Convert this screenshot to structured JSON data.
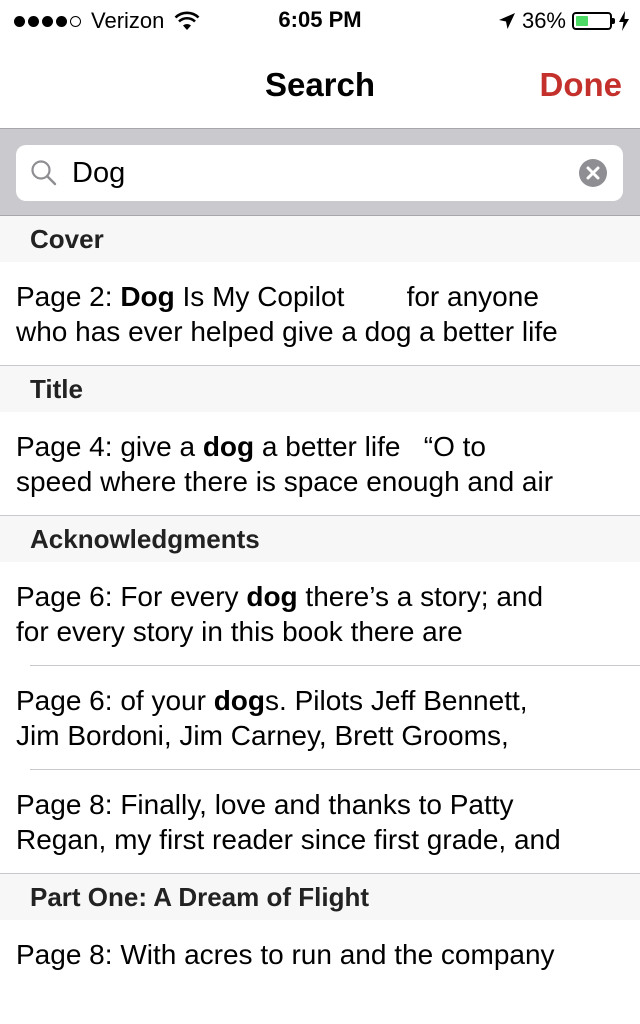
{
  "status_bar": {
    "carrier": "Verizon",
    "time": "6:05 PM",
    "battery": "36%",
    "battery_level": 0.36,
    "signal_bars_filled": 4,
    "signal_bars_total": 5
  },
  "nav": {
    "title": "Search",
    "done_label": "Done"
  },
  "search": {
    "value": "Dog"
  },
  "colors": {
    "accent": "#c4302b",
    "battery_fill": "#4cd964"
  },
  "sections": [
    {
      "header": "Cover",
      "results": [
        {
          "page": "Page 2: ",
          "line1_before": "",
          "match": "Dog",
          "line1_after": " Is My Copilot        for anyone",
          "line2": "who has ever helped give a dog a better life"
        }
      ]
    },
    {
      "header": "Title",
      "results": [
        {
          "page": "Page 4: ",
          "line1_before": "give a ",
          "match": "dog",
          "line1_after": " a better life   “O to",
          "line2": "speed where there is space enough and air"
        }
      ]
    },
    {
      "header": "Acknowledgments",
      "results": [
        {
          "page": "Page 6: ",
          "line1_before": "For every ",
          "match": "dog",
          "line1_after": " there’s a story; and",
          "line2": "for every story in this book there are"
        },
        {
          "page": "Page 6: ",
          "line1_before": "of your ",
          "match": "dog",
          "line1_after": "s. Pilots Jeff Bennett,",
          "line2": "Jim Bordoni, Jim Carney, Brett Grooms,"
        },
        {
          "page": "Page 8: ",
          "line1_before": "Finally, love and thanks to Patty",
          "match": "",
          "line1_after": "",
          "line2": "Regan, my first reader since first grade, and"
        }
      ]
    },
    {
      "header": "Part One: A Dream of Flight",
      "results": [
        {
          "page": "Page 8: ",
          "line1_before": "With acres to run and the company",
          "match": "",
          "line1_after": "",
          "line2": ""
        }
      ]
    }
  ]
}
